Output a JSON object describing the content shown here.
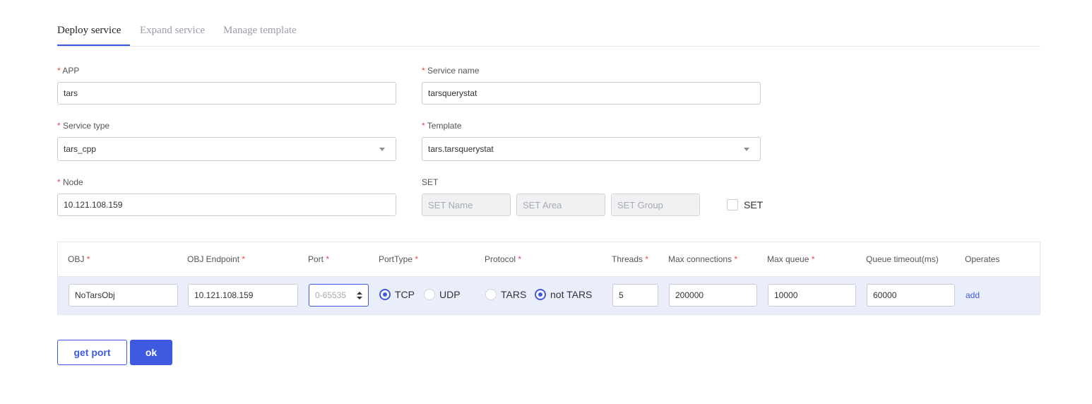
{
  "tabs": [
    "Deploy service",
    "Expand service",
    "Manage template"
  ],
  "form": {
    "app": {
      "label": "APP",
      "value": "tars"
    },
    "service_name": {
      "label": "Service name",
      "value": "tarsquerystat"
    },
    "service_type": {
      "label": "Service type",
      "value": "tars_cpp"
    },
    "template": {
      "label": "Template",
      "value": "tars.tarsquerystat"
    },
    "node": {
      "label": "Node",
      "value": "10.121.108.159"
    },
    "set": {
      "label": "SET",
      "name_placeholder": "SET Name",
      "area_placeholder": "SET Area",
      "group_placeholder": "SET Group",
      "checkbox_label": "SET",
      "checked": false
    },
    "required_mark": "*"
  },
  "table": {
    "headers": [
      "OBJ",
      "OBJ Endpoint",
      "Port",
      "PortType",
      "Protocol",
      "Threads",
      "Max connections",
      "Max queue",
      "Queue timeout(ms)",
      "Operates"
    ],
    "row": {
      "obj": "NoTarsObj",
      "endpoint": "10.121.108.159",
      "port_placeholder": "0-65535",
      "port_types": [
        "TCP",
        "UDP"
      ],
      "port_type_selected": "TCP",
      "protocols": [
        "TARS",
        "not TARS"
      ],
      "protocol_selected": "not TARS",
      "threads": "5",
      "max_connections": "200000",
      "max_queue": "10000",
      "queue_timeout": "60000",
      "operate": "add"
    }
  },
  "buttons": {
    "get_port": "get port",
    "ok": "ok"
  },
  "colors": {
    "accent": "#3f5ae0",
    "required": "#e8484a",
    "row_bg": "#eaeefb"
  }
}
